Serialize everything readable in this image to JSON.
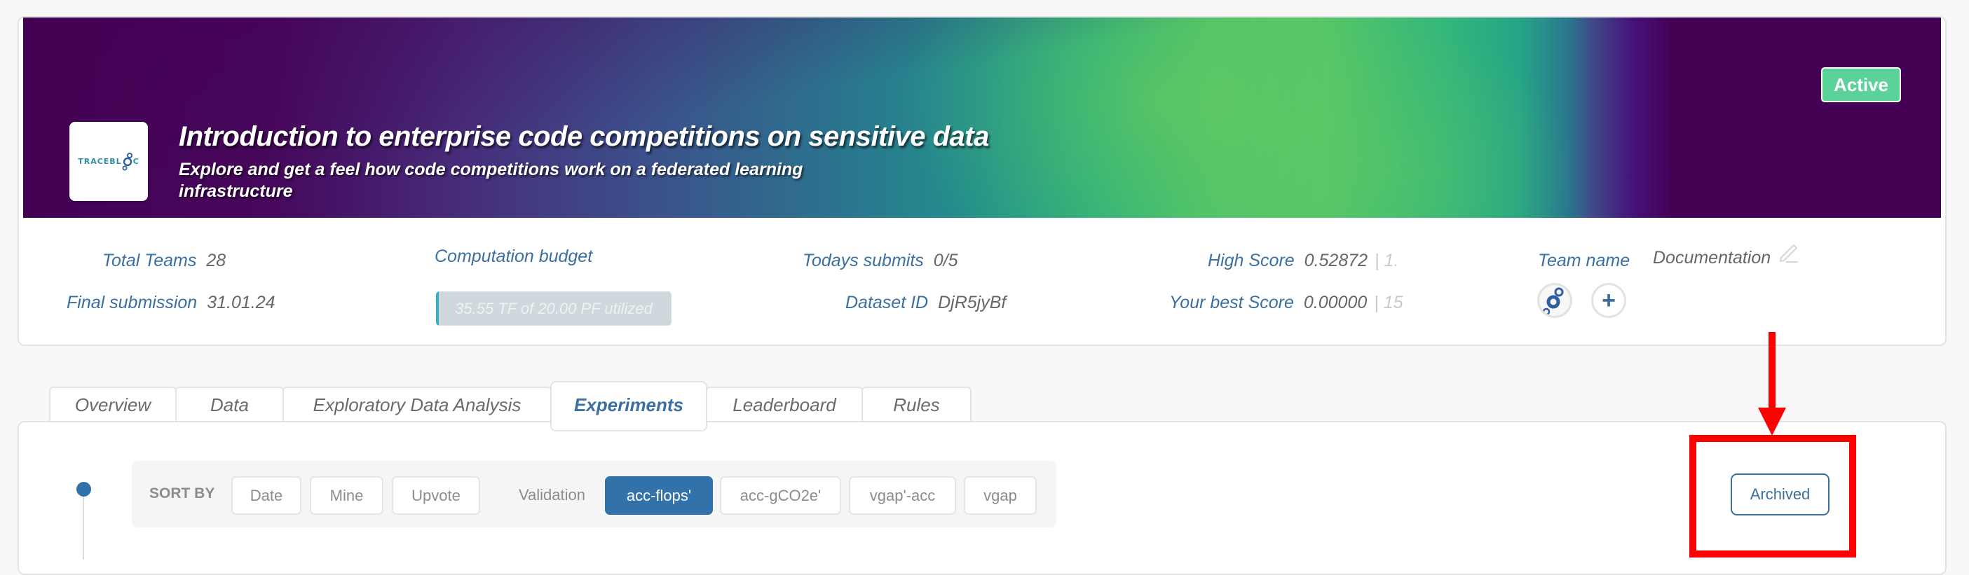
{
  "header": {
    "logo_text": "TRACEBL",
    "logo_suffix": "C",
    "title": "Introduction to enterprise code competitions on sensitive data",
    "subtitle": "Explore and get a feel how code competitions work on a federated learning infrastructure",
    "status_badge": "Active",
    "status_color": "#5cd29b"
  },
  "stats": {
    "total_teams": {
      "label": "Total Teams",
      "value": "28"
    },
    "final_submission": {
      "label": "Final submission",
      "value": "31.01.24"
    },
    "computation_budget": {
      "label": "Computation budget",
      "bar_text": "35.55 TF of 20.00 PF utilized",
      "utilized_fraction": 0.0018
    },
    "todays_submits": {
      "label": "Todays submits",
      "value": "0/5"
    },
    "dataset_id": {
      "label": "Dataset ID",
      "value": "DjR5jyBf"
    },
    "high_score": {
      "label": "High Score",
      "value": "0.52872",
      "rank": "| 1."
    },
    "your_best_score": {
      "label": "Your best Score",
      "value": "0.00000",
      "rank": "| 15"
    },
    "team_name": {
      "label": "Team name",
      "value": "Documentation",
      "edit_icon": "pencil-icon"
    },
    "add_member_icon": "plus-icon"
  },
  "tabs": [
    {
      "label": "Overview",
      "active": false
    },
    {
      "label": "Data",
      "active": false
    },
    {
      "label": "Exploratory Data Analysis",
      "active": false
    },
    {
      "label": "Experiments",
      "active": true
    },
    {
      "label": "Leaderboard",
      "active": false
    },
    {
      "label": "Rules",
      "active": false
    }
  ],
  "experiments": {
    "sort_by_label": "SORT BY",
    "sort_options": [
      "Date",
      "Mine",
      "Upvote"
    ],
    "validation_label": "Validation",
    "validation_options": [
      {
        "label": "acc-flops'",
        "selected": true
      },
      {
        "label": "acc-gCO2e'",
        "selected": false
      },
      {
        "label": "vgap'-acc",
        "selected": false
      },
      {
        "label": "vgap",
        "selected": false
      }
    ],
    "archived_button": "Archived"
  },
  "colors": {
    "accent": "#3272aa",
    "label_blue": "#3a6fa0",
    "annotation_red": "#ff0000"
  }
}
